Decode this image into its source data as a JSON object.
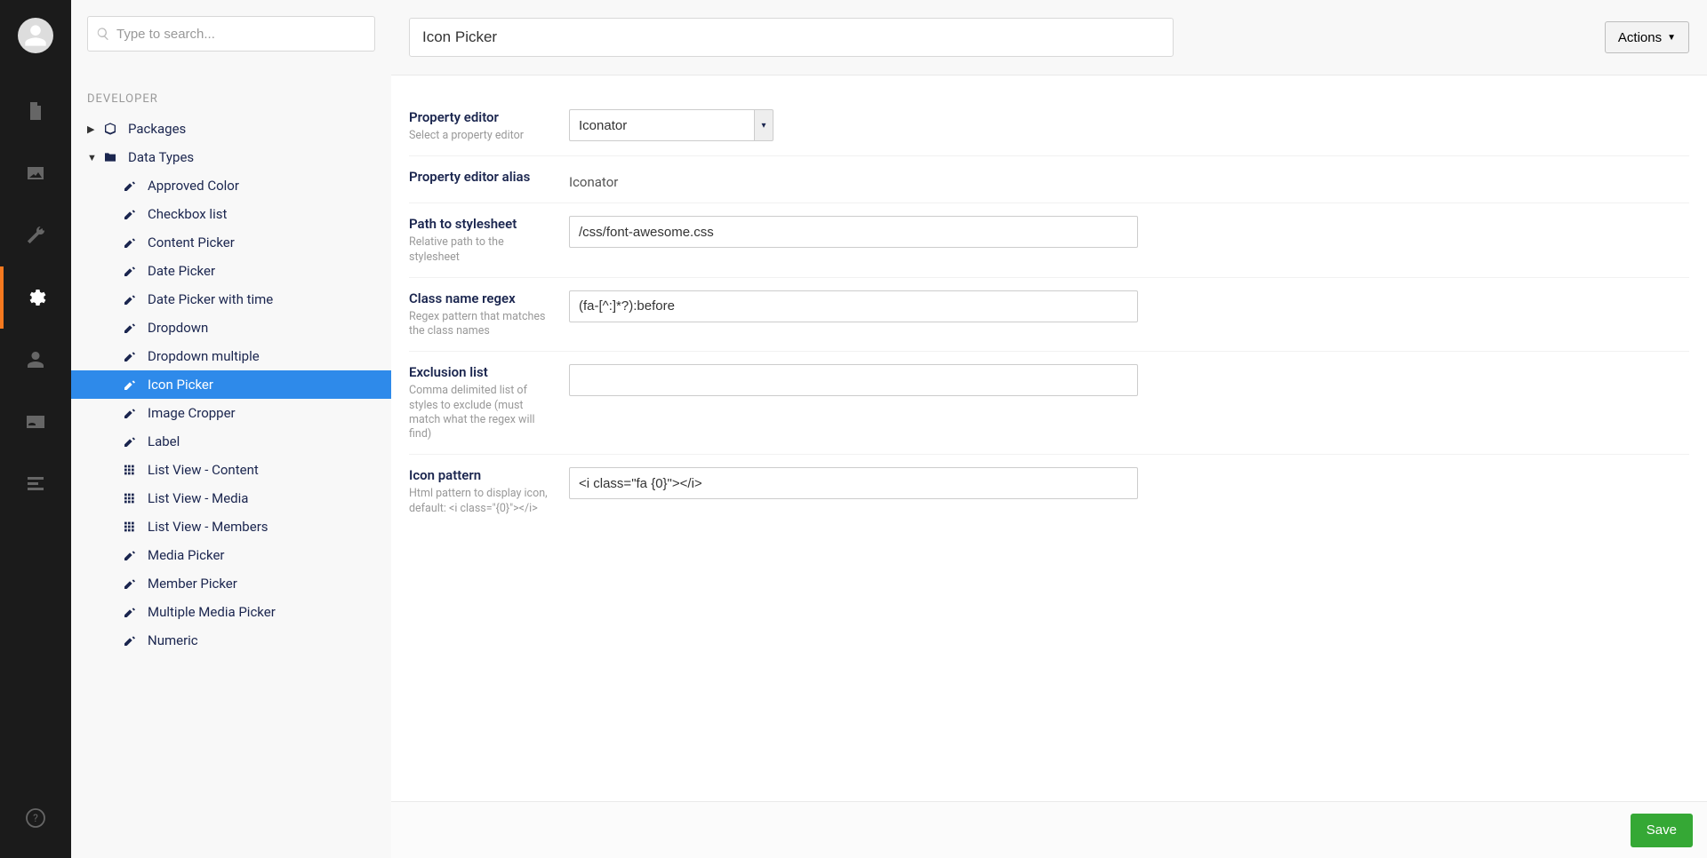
{
  "search": {
    "placeholder": "Type to search..."
  },
  "tree": {
    "header": "DEVELOPER",
    "packages_label": "Packages",
    "datatypes_label": "Data Types",
    "items": [
      {
        "label": "Approved Color",
        "icon": "autofill"
      },
      {
        "label": "Checkbox list",
        "icon": "autofill"
      },
      {
        "label": "Content Picker",
        "icon": "autofill"
      },
      {
        "label": "Date Picker",
        "icon": "autofill"
      },
      {
        "label": "Date Picker with time",
        "icon": "autofill"
      },
      {
        "label": "Dropdown",
        "icon": "autofill"
      },
      {
        "label": "Dropdown multiple",
        "icon": "autofill"
      },
      {
        "label": "Icon Picker",
        "icon": "autofill",
        "selected": true
      },
      {
        "label": "Image Cropper",
        "icon": "autofill"
      },
      {
        "label": "Label",
        "icon": "autofill"
      },
      {
        "label": "List View - Content",
        "icon": "grid"
      },
      {
        "label": "List View - Media",
        "icon": "grid"
      },
      {
        "label": "List View - Members",
        "icon": "grid"
      },
      {
        "label": "Media Picker",
        "icon": "autofill"
      },
      {
        "label": "Member Picker",
        "icon": "autofill"
      },
      {
        "label": "Multiple Media Picker",
        "icon": "autofill"
      },
      {
        "label": "Numeric",
        "icon": "autofill"
      }
    ]
  },
  "header": {
    "title_value": "Icon Picker",
    "actions_label": "Actions"
  },
  "form": {
    "property_editor": {
      "label": "Property editor",
      "desc": "Select a property editor",
      "value": "Iconator"
    },
    "alias": {
      "label": "Property editor alias",
      "value": "Iconator"
    },
    "stylesheet": {
      "label": "Path to stylesheet",
      "desc": "Relative path to the stylesheet",
      "value": "/css/font-awesome.css"
    },
    "regex": {
      "label": "Class name regex",
      "desc": "Regex pattern that matches the class names",
      "value": "(fa-[^:]*?):before"
    },
    "exclusion": {
      "label": "Exclusion list",
      "desc": "Comma delimited list of styles to exclude (must match what the regex will find)",
      "value": ""
    },
    "pattern": {
      "label": "Icon pattern",
      "desc": "Html pattern to display icon, default: <i class=\"{0}\"></i>",
      "value": "<i class=\"fa {0}\"></i>"
    }
  },
  "footer": {
    "save_label": "Save"
  }
}
